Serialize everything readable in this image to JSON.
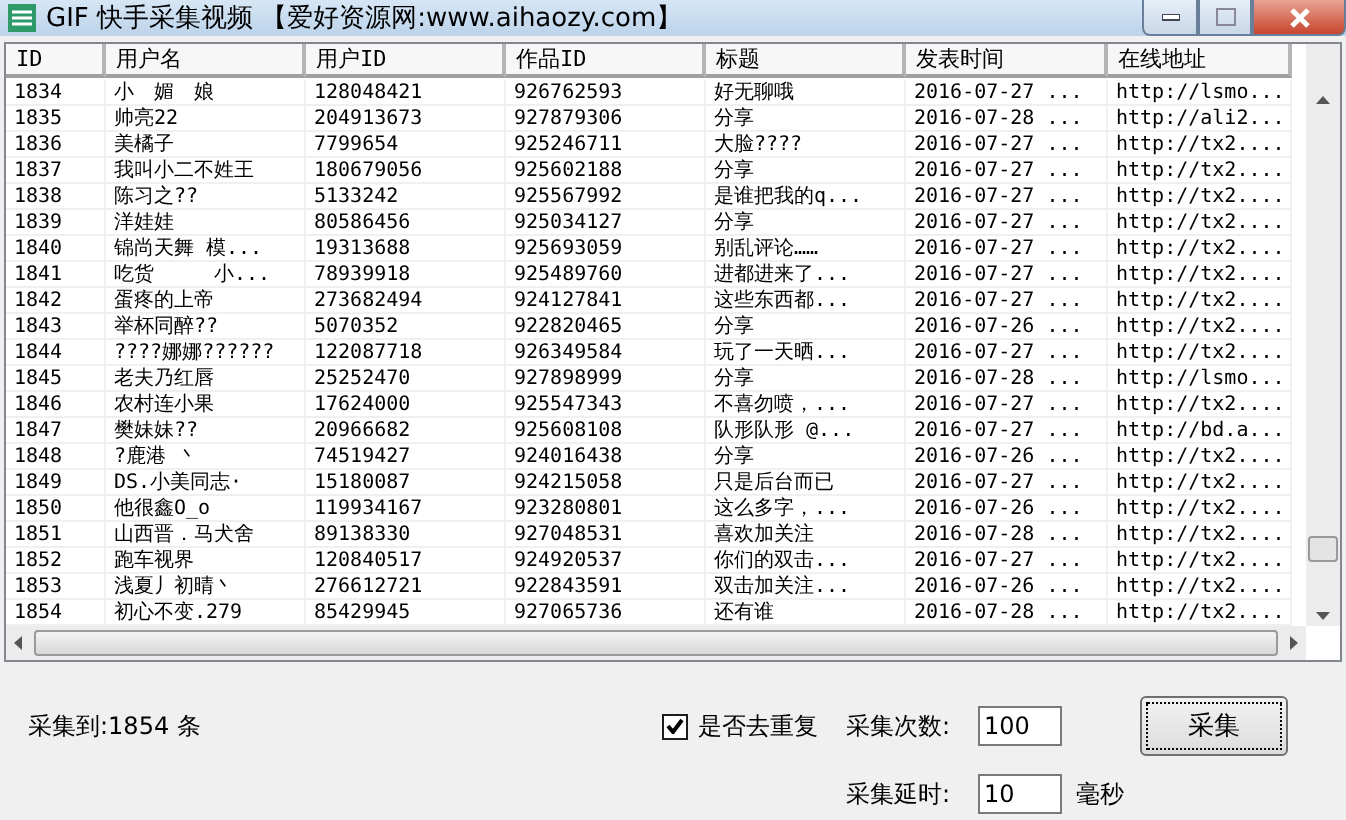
{
  "window": {
    "title": "GIF 快手采集视频 【爱好资源网:www.aihaozy.com】"
  },
  "table": {
    "columns": [
      "ID",
      "用户名",
      "用户ID",
      "作品ID",
      "标题",
      "发表时间",
      "在线地址"
    ],
    "rows": [
      [
        "1834",
        "小　媚　娘",
        "128048421",
        "926762593",
        "好无聊哦",
        "2016-07-27 ...",
        "http://lsmo..."
      ],
      [
        "1835",
        "帅亮22",
        "204913673",
        "927879306",
        "分享",
        "2016-07-28 ...",
        "http://ali2..."
      ],
      [
        "1836",
        "美橘子",
        "7799654",
        "925246711",
        "大脸????",
        "2016-07-27 ...",
        "http://tx2...."
      ],
      [
        "1837",
        "我叫小二不姓王",
        "180679056",
        "925602188",
        "分享",
        "2016-07-27 ...",
        "http://tx2...."
      ],
      [
        "1838",
        "陈习之??",
        "5133242",
        "925567992",
        "是谁把我的q...",
        "2016-07-27 ...",
        "http://tx2...."
      ],
      [
        "1839",
        "洋娃娃",
        "80586456",
        "925034127",
        "分享",
        "2016-07-27 ...",
        "http://tx2...."
      ],
      [
        "1840",
        "锦尚天舞 模...",
        "19313688",
        "925693059",
        "别乱评论……",
        "2016-07-27 ...",
        "http://tx2...."
      ],
      [
        "1841",
        "吃货　　　小...",
        "78939918",
        "925489760",
        "进都进来了...",
        "2016-07-27 ...",
        "http://tx2...."
      ],
      [
        "1842",
        "蛋疼的上帝",
        "273682494",
        "924127841",
        "这些东西都...",
        "2016-07-27 ...",
        "http://tx2...."
      ],
      [
        "1843",
        "举杯同醉??",
        "5070352",
        "922820465",
        "分享",
        "2016-07-26 ...",
        "http://tx2...."
      ],
      [
        "1844",
        "????娜娜??????",
        "122087718",
        "926349584",
        "玩了一天晒...",
        "2016-07-27 ...",
        "http://tx2...."
      ],
      [
        "1845",
        "老夫乃红唇",
        "25252470",
        "927898999",
        "分享",
        "2016-07-28 ...",
        "http://lsmo..."
      ],
      [
        "1846",
        "农村连小果",
        "17624000",
        "925547343",
        "不喜勿喷，...",
        "2016-07-27 ...",
        "http://tx2...."
      ],
      [
        "1847",
        "樊妹妹??",
        "20966682",
        "925608108",
        "队形队形 @...",
        "2016-07-27 ...",
        "http://bd.a..."
      ],
      [
        "1848",
        "?鹿港 丶",
        "74519427",
        "924016438",
        "分享",
        "2016-07-26 ...",
        "http://tx2...."
      ],
      [
        "1849",
        "DS.小美同志·",
        "15180087",
        "924215058",
        "只是后台而已",
        "2016-07-27 ...",
        "http://tx2...."
      ],
      [
        "1850",
        "他很鑫O_o",
        "119934167",
        "923280801",
        "这么多字，...",
        "2016-07-26 ...",
        "http://tx2...."
      ],
      [
        "1851",
        "山西晋．马犬舍",
        "89138330",
        "927048531",
        "喜欢加关注",
        "2016-07-28 ...",
        "http://tx2...."
      ],
      [
        "1852",
        "跑车视界",
        "120840517",
        "924920537",
        "你们的双击...",
        "2016-07-27 ...",
        "http://tx2...."
      ],
      [
        "1853",
        "浅夏丿初晴丶",
        "276612721",
        "922843591",
        "双击加关注...",
        "2016-07-26 ...",
        "http://tx2...."
      ],
      [
        "1854",
        "初心不变.279",
        "85429945",
        "927065736",
        "还有谁",
        "2016-07-28 ...",
        "http://tx2...."
      ]
    ]
  },
  "status": {
    "count": "采集到:1854 条"
  },
  "dedupe": {
    "label": "是否去重复",
    "checked": true
  },
  "times": {
    "label": "采集次数:",
    "value": "100"
  },
  "delay": {
    "label": "采集延时:",
    "value": "10",
    "unit": "毫秒"
  },
  "collect_button": "采集"
}
